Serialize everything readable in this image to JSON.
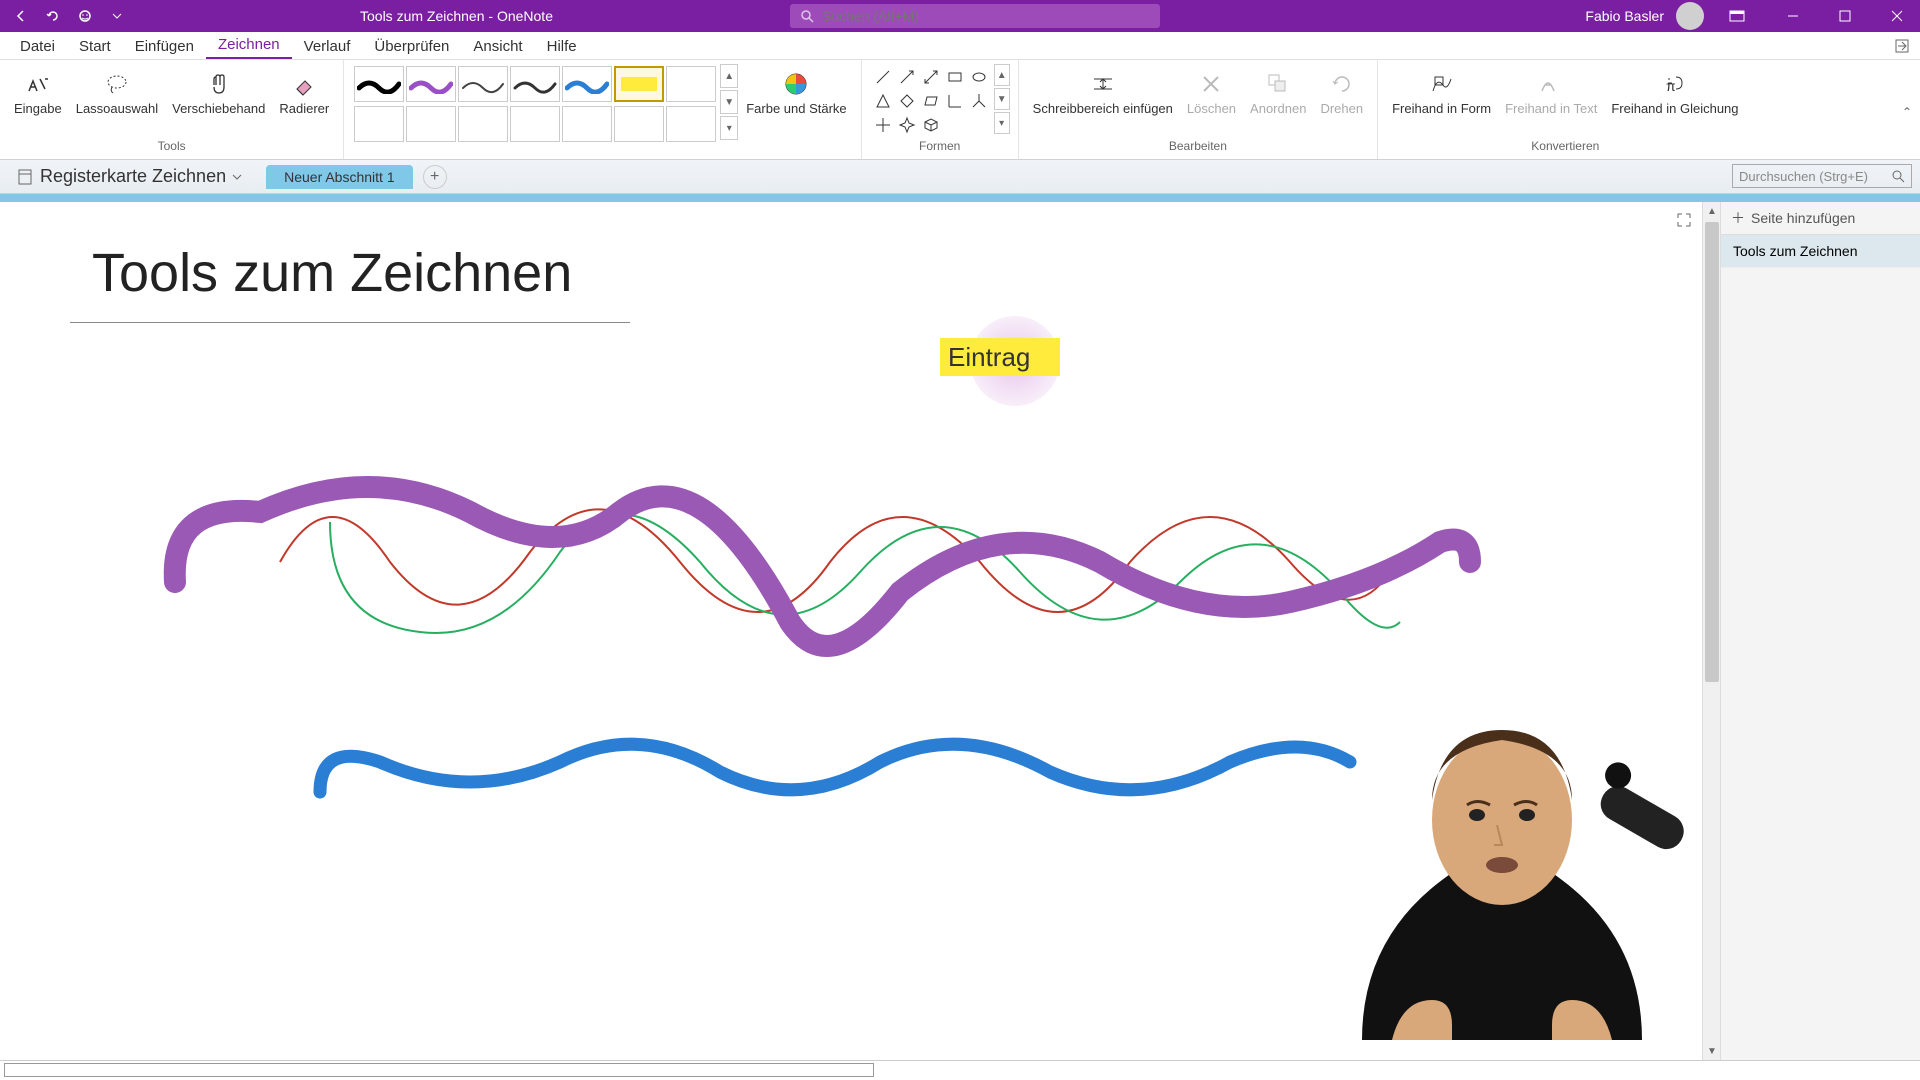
{
  "titlebar": {
    "title": "Tools zum Zeichnen  -  OneNote",
    "search_placeholder": "Suchen (Alt+M)",
    "user": "Fabio Basler"
  },
  "menu": {
    "items": [
      "Datei",
      "Start",
      "Einfügen",
      "Zeichnen",
      "Verlauf",
      "Überprüfen",
      "Ansicht",
      "Hilfe"
    ],
    "active": 3
  },
  "ribbon": {
    "tools": {
      "eingabe": "Eingabe",
      "lasso": "Lassoauswahl",
      "hand": "Verschiebehand",
      "eraser": "Radierer",
      "group": "Tools"
    },
    "color": {
      "label": "Farbe und Stärke"
    },
    "shapes": {
      "group": "Formen"
    },
    "edit": {
      "insert_space": "Schreibbereich einfügen",
      "delete": "Löschen",
      "arrange": "Anordnen",
      "rotate": "Drehen",
      "group": "Bearbeiten"
    },
    "convert": {
      "to_shape": "Freihand in Form",
      "to_text": "Freihand in Text",
      "to_math": "Freihand in Gleichung",
      "group": "Konvertieren"
    }
  },
  "notebook": {
    "name": "Registerkarte Zeichnen",
    "section": "Neuer Abschnitt 1",
    "search_placeholder": "Durchsuchen (Strg+E)"
  },
  "pagepanel": {
    "add_page": "Seite hinzufügen",
    "pages": [
      "Tools zum Zeichnen"
    ]
  },
  "page": {
    "title": "Tools zum Zeichnen",
    "highlight_text": "Eintrag"
  }
}
